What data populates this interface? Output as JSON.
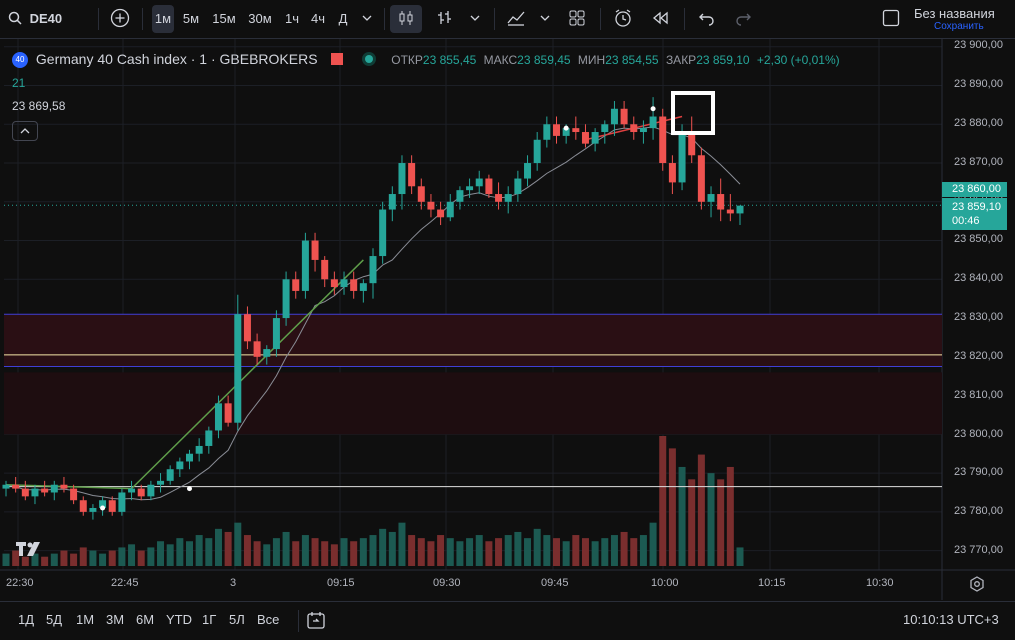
{
  "toolbar": {
    "symbol": "DE40",
    "intervals": [
      "1м",
      "5м",
      "15м",
      "30м",
      "1ч",
      "4ч",
      "Д"
    ],
    "active_interval": "1м",
    "layout_title": "Без названия",
    "layout_status": "Сохранить"
  },
  "legend": {
    "instrument": "Germany 40 Cash index · 1 · GBEBROKERS",
    "badge": "40",
    "open_label": "ОТКР",
    "open": "23 855,45",
    "high_label": "МАКС",
    "high": "23 859,45",
    "low_label": "МИН",
    "low": "23 854,55",
    "close_label": "ЗАКР",
    "close": "23 859,10",
    "change": "+2,30 (+0,01%)",
    "indicator_value": "21",
    "price_marker": "23 869,58"
  },
  "price_axis": {
    "labels": [
      "23 900,00",
      "23 890,00",
      "23 880,00",
      "23 870,00",
      "23 860,00",
      "23 850,00",
      "23 840,00",
      "23 830,00",
      "23 820,00",
      "23 810,00",
      "23 800,00",
      "23 790,00",
      "23 780,00",
      "23 770,00"
    ],
    "current_price": "23 859,10",
    "countdown": "00:46",
    "highlight_price": "23 860,00"
  },
  "time_axis": {
    "labels": [
      "22:30",
      "22:45",
      "3",
      "09:15",
      "09:30",
      "09:45",
      "10:00",
      "10:15",
      "10:30"
    ]
  },
  "bottom": {
    "ranges": [
      "1Д",
      "5Д",
      "1М",
      "3М",
      "6М",
      "YTD",
      "1Г",
      "5Л",
      "Все"
    ],
    "clock": "10:10:13 UTC+3"
  },
  "colors": {
    "up": "#26a69a",
    "down": "#ef5350",
    "background": "#0f0f0f",
    "grid": "#1c1f26"
  },
  "chart_data": {
    "type": "candlestick",
    "x_unit": "1-minute bars",
    "ylim": [
      23765,
      23902
    ],
    "candles": [
      [
        23786,
        23788,
        23784,
        23787
      ],
      [
        23787,
        23789,
        23785,
        23786
      ],
      [
        23786,
        23788,
        23783,
        23784
      ],
      [
        23784,
        23787,
        23782,
        23786
      ],
      [
        23786,
        23788,
        23784,
        23785
      ],
      [
        23785,
        23788,
        23783,
        23787
      ],
      [
        23787,
        23789,
        23785,
        23786
      ],
      [
        23786,
        23787,
        23782,
        23783
      ],
      [
        23783,
        23784,
        23779,
        23780
      ],
      [
        23780,
        23782,
        23778,
        23781
      ],
      [
        23781,
        23784,
        23779,
        23783
      ],
      [
        23783,
        23784,
        23779,
        23780
      ],
      [
        23780,
        23786,
        23779,
        23785
      ],
      [
        23785,
        23788,
        23783,
        23786
      ],
      [
        23786,
        23787,
        23783,
        23784
      ],
      [
        23784,
        23788,
        23783,
        23787
      ],
      [
        23787,
        23790,
        23785,
        23788
      ],
      [
        23788,
        23792,
        23787,
        23791
      ],
      [
        23791,
        23794,
        23789,
        23793
      ],
      [
        23793,
        23796,
        23791,
        23795
      ],
      [
        23795,
        23799,
        23793,
        23797
      ],
      [
        23797,
        23802,
        23795,
        23801
      ],
      [
        23801,
        23810,
        23799,
        23808
      ],
      [
        23808,
        23810,
        23802,
        23803
      ],
      [
        23803,
        23836,
        23801,
        23831
      ],
      [
        23831,
        23833,
        23822,
        23824
      ],
      [
        23824,
        23826,
        23818,
        23820
      ],
      [
        23820,
        23823,
        23818,
        23822
      ],
      [
        23822,
        23832,
        23820,
        23830
      ],
      [
        23830,
        23842,
        23828,
        23840
      ],
      [
        23840,
        23842,
        23835,
        23837
      ],
      [
        23837,
        23852,
        23835,
        23850
      ],
      [
        23850,
        23852,
        23842,
        23845
      ],
      [
        23845,
        23846,
        23838,
        23840
      ],
      [
        23840,
        23842,
        23836,
        23838
      ],
      [
        23838,
        23842,
        23836,
        23840
      ],
      [
        23840,
        23842,
        23835,
        23837
      ],
      [
        23837,
        23840,
        23834,
        23839
      ],
      [
        23839,
        23848,
        23835,
        23846
      ],
      [
        23846,
        23860,
        23844,
        23858
      ],
      [
        23858,
        23864,
        23855,
        23862
      ],
      [
        23862,
        23872,
        23858,
        23870
      ],
      [
        23870,
        23872,
        23862,
        23864
      ],
      [
        23864,
        23866,
        23858,
        23860
      ],
      [
        23860,
        23862,
        23856,
        23858
      ],
      [
        23858,
        23860,
        23854,
        23856
      ],
      [
        23856,
        23862,
        23855,
        23860
      ],
      [
        23860,
        23864,
        23858,
        23863
      ],
      [
        23863,
        23866,
        23861,
        23864
      ],
      [
        23864,
        23868,
        23862,
        23866
      ],
      [
        23866,
        23867,
        23861,
        23862
      ],
      [
        23862,
        23865,
        23858,
        23860
      ],
      [
        23860,
        23864,
        23857,
        23862
      ],
      [
        23862,
        23868,
        23860,
        23866
      ],
      [
        23866,
        23872,
        23864,
        23870
      ],
      [
        23870,
        23878,
        23868,
        23876
      ],
      [
        23876,
        23882,
        23874,
        23880
      ],
      [
        23880,
        23882,
        23875,
        23877
      ],
      [
        23877,
        23880,
        23875,
        23879
      ],
      [
        23879,
        23882,
        23876,
        23878
      ],
      [
        23878,
        23880,
        23874,
        23875
      ],
      [
        23875,
        23879,
        23873,
        23878
      ],
      [
        23878,
        23881,
        23875,
        23880
      ],
      [
        23880,
        23886,
        23877,
        23884
      ],
      [
        23884,
        23886,
        23879,
        23880
      ],
      [
        23880,
        23882,
        23876,
        23878
      ],
      [
        23878,
        23881,
        23875,
        23879
      ],
      [
        23879,
        23887,
        23876,
        23882
      ],
      [
        23882,
        23884,
        23868,
        23870
      ],
      [
        23870,
        23872,
        23862,
        23865
      ],
      [
        23865,
        23880,
        23863,
        23878
      ],
      [
        23878,
        23882,
        23870,
        23872
      ],
      [
        23872,
        23874,
        23858,
        23860
      ],
      [
        23860,
        23864,
        23856,
        23862
      ],
      [
        23862,
        23866,
        23855,
        23858
      ],
      [
        23858,
        23862,
        23855,
        23857
      ],
      [
        23857,
        23859,
        23854,
        23859
      ]
    ],
    "volume": [
      4,
      5,
      3,
      4,
      3,
      4,
      5,
      4,
      6,
      5,
      4,
      5,
      6,
      7,
      5,
      6,
      8,
      7,
      9,
      8,
      10,
      9,
      12,
      11,
      14,
      10,
      8,
      7,
      9,
      11,
      8,
      10,
      9,
      8,
      7,
      9,
      8,
      9,
      10,
      12,
      11,
      14,
      10,
      9,
      8,
      10,
      9,
      8,
      9,
      10,
      8,
      9,
      10,
      11,
      9,
      12,
      10,
      9,
      8,
      10,
      9,
      8,
      9,
      10,
      11,
      9,
      10,
      14,
      42,
      38,
      32,
      28,
      36,
      30,
      28,
      32,
      6
    ],
    "horizontal_lines": [
      {
        "price": 23831,
        "color": "#3f3fd6"
      },
      {
        "price": 23820.5,
        "color": "#f5e6a8"
      },
      {
        "price": 23817.5,
        "color": "#3f3fd6"
      },
      {
        "price": 23786.5,
        "color": "#e0e0e0"
      }
    ],
    "shaded_zone": [
      23817.5,
      23831
    ]
  }
}
